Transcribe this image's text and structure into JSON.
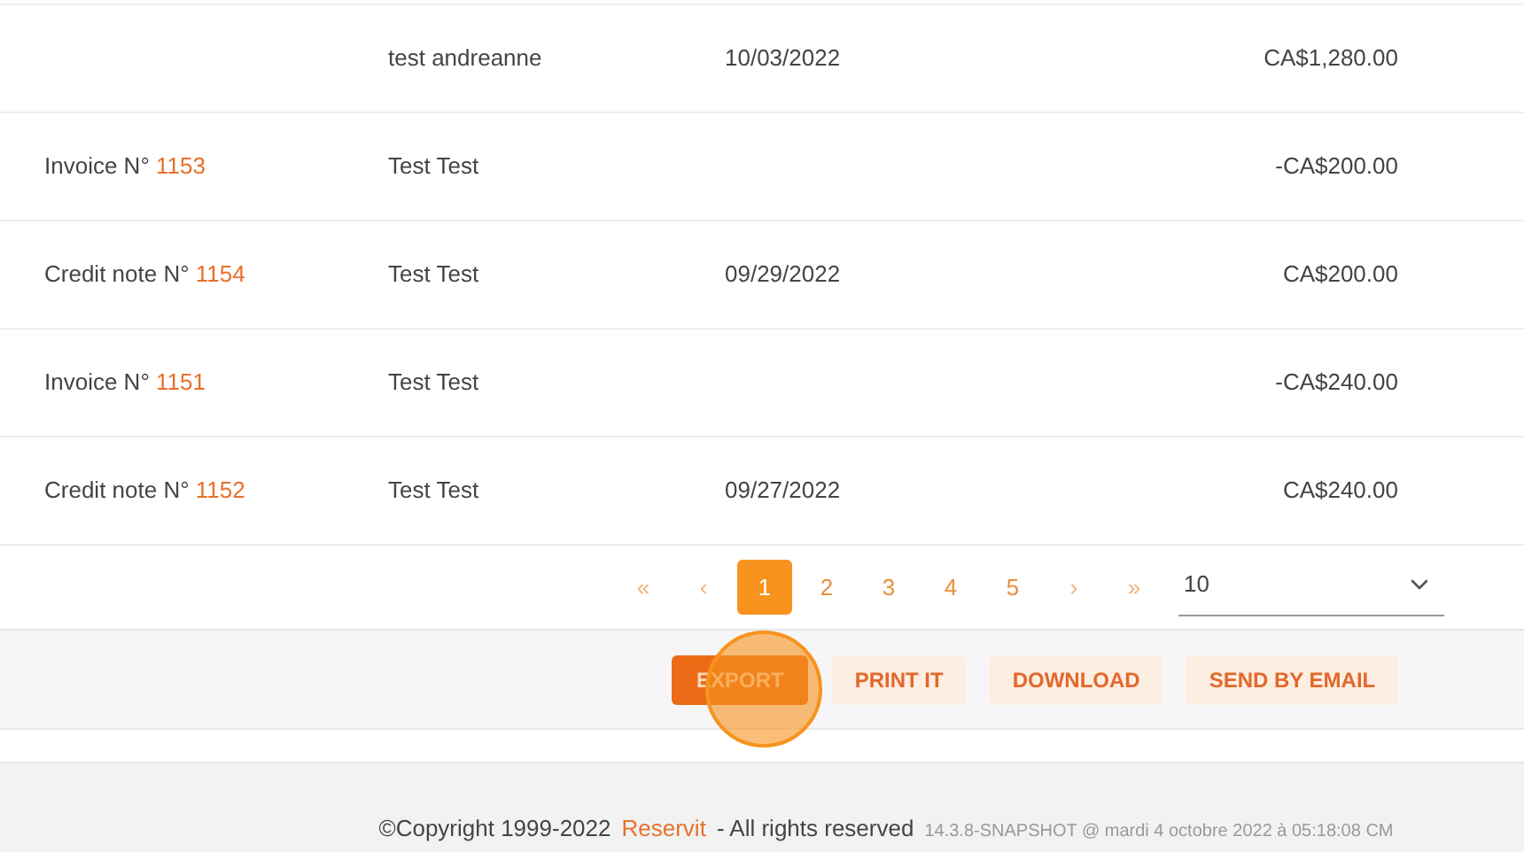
{
  "table": {
    "rows": [
      {
        "document_label": "",
        "document_number": "",
        "client": "test andreanne",
        "date": "10/03/2022",
        "amount": "CA$1,280.00"
      },
      {
        "document_label": "Invoice N°",
        "document_number": "1153",
        "client": "Test Test",
        "date": "",
        "amount": "-CA$200.00"
      },
      {
        "document_label": "Credit note N°",
        "document_number": "1154",
        "client": "Test Test",
        "date": "09/29/2022",
        "amount": "CA$200.00"
      },
      {
        "document_label": "Invoice N°",
        "document_number": "1151",
        "client": "Test Test",
        "date": "",
        "amount": "-CA$240.00"
      },
      {
        "document_label": "Credit note N°",
        "document_number": "1152",
        "client": "Test Test",
        "date": "09/27/2022",
        "amount": "CA$240.00"
      }
    ]
  },
  "pagination": {
    "first": "«",
    "previous": "‹",
    "pages": [
      {
        "label": "1",
        "selected": true
      },
      {
        "label": "2",
        "selected": false
      },
      {
        "label": "3",
        "selected": false
      },
      {
        "label": "4",
        "selected": false
      },
      {
        "label": "5",
        "selected": false
      }
    ],
    "next": "›",
    "last": "»",
    "page_size": "10"
  },
  "actions": [
    {
      "label": "EXPORT",
      "kind": "primary"
    },
    {
      "label": "PRINT IT",
      "kind": "secondary"
    },
    {
      "label": "DOWNLOAD",
      "kind": "secondary"
    },
    {
      "label": "SEND BY EMAIL",
      "kind": "secondary"
    }
  ],
  "footer": {
    "copyright": "©Copyright 1999-2022",
    "brand": "Reservit",
    "rights": "- All rights reserved",
    "version": "14.3.8-SNAPSHOT @ mardi 4 octobre 2022 à 05:18:08 CM"
  }
}
